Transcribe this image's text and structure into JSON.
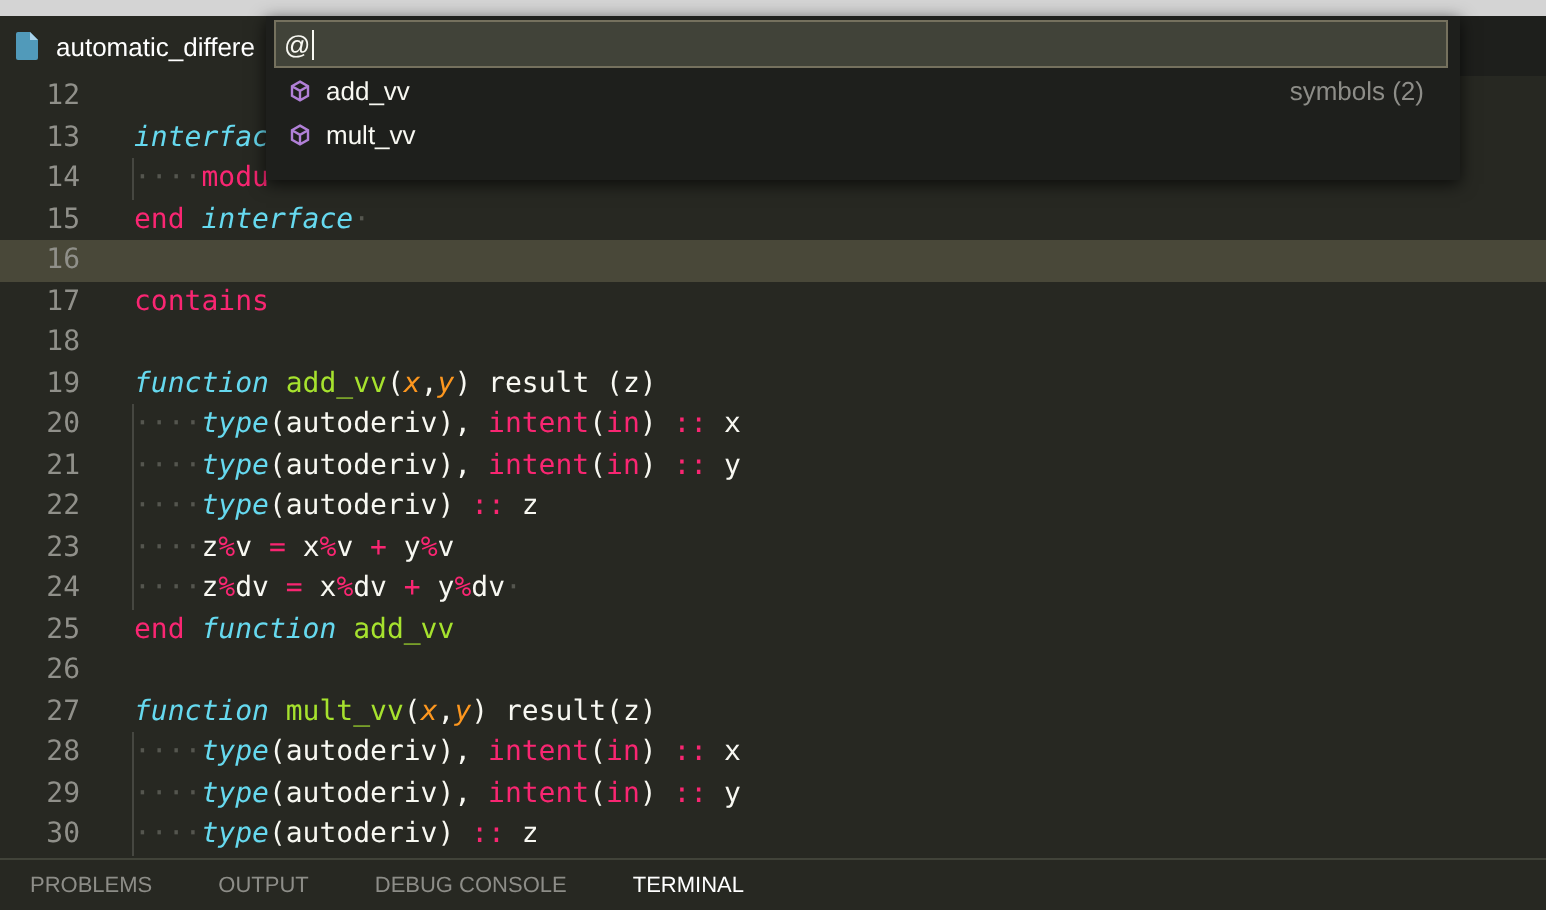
{
  "tab": {
    "title": "automatic_differe"
  },
  "command_palette": {
    "query": "@",
    "hint": "symbols (2)",
    "results": [
      {
        "label": "add_vv"
      },
      {
        "label": "mult_vv"
      }
    ]
  },
  "editor": {
    "lines": [
      {
        "number": "12",
        "current": false
      },
      {
        "number": "13",
        "current": false,
        "tokens": [
          {
            "kind": "storage",
            "text": "interfac"
          }
        ]
      },
      {
        "number": "14",
        "current": false,
        "tokens": [
          {
            "kind": "ws",
            "text": "····"
          },
          {
            "kind": "kw",
            "text": "modu"
          }
        ]
      },
      {
        "number": "15",
        "current": false,
        "tokens": [
          {
            "kind": "kw",
            "text": "end"
          },
          {
            "kind": "storage",
            "text": " interface"
          },
          {
            "kind": "ws",
            "text": "·"
          }
        ]
      },
      {
        "number": "16",
        "current": true
      },
      {
        "number": "17",
        "current": false,
        "tokens": [
          {
            "kind": "kw",
            "text": "contains"
          }
        ]
      },
      {
        "number": "18",
        "current": false
      },
      {
        "number": "19",
        "current": false,
        "tokens": [
          {
            "kind": "storage",
            "text": "function"
          },
          {
            "kind": "fn",
            "text": " add_vv"
          },
          {
            "kind": "plain",
            "text": "("
          },
          {
            "kind": "param",
            "text": "x"
          },
          {
            "kind": "plain",
            "text": ","
          },
          {
            "kind": "param",
            "text": "y"
          },
          {
            "kind": "plain",
            "text": ") result (z)"
          }
        ]
      },
      {
        "number": "20",
        "current": false,
        "tokens": [
          {
            "kind": "ws",
            "text": "····"
          },
          {
            "kind": "storage",
            "text": "type"
          },
          {
            "kind": "plain",
            "text": "(autoderiv), "
          },
          {
            "kind": "kw",
            "text": "intent"
          },
          {
            "kind": "plain",
            "text": "("
          },
          {
            "kind": "kw",
            "text": "in"
          },
          {
            "kind": "plain",
            "text": ") "
          },
          {
            "kind": "kw",
            "text": "::"
          },
          {
            "kind": "plain",
            "text": " x"
          }
        ]
      },
      {
        "number": "21",
        "current": false,
        "tokens": [
          {
            "kind": "ws",
            "text": "····"
          },
          {
            "kind": "storage",
            "text": "type"
          },
          {
            "kind": "plain",
            "text": "(autoderiv), "
          },
          {
            "kind": "kw",
            "text": "intent"
          },
          {
            "kind": "plain",
            "text": "("
          },
          {
            "kind": "kw",
            "text": "in"
          },
          {
            "kind": "plain",
            "text": ") "
          },
          {
            "kind": "kw",
            "text": "::"
          },
          {
            "kind": "plain",
            "text": " y"
          }
        ]
      },
      {
        "number": "22",
        "current": false,
        "tokens": [
          {
            "kind": "ws",
            "text": "····"
          },
          {
            "kind": "storage",
            "text": "type"
          },
          {
            "kind": "plain",
            "text": "(autoderiv) "
          },
          {
            "kind": "kw",
            "text": "::"
          },
          {
            "kind": "plain",
            "text": " z"
          }
        ]
      },
      {
        "number": "23",
        "current": false,
        "tokens": [
          {
            "kind": "ws",
            "text": "····"
          },
          {
            "kind": "plain",
            "text": "z"
          },
          {
            "kind": "kw",
            "text": "%"
          },
          {
            "kind": "plain",
            "text": "v "
          },
          {
            "kind": "kw",
            "text": "="
          },
          {
            "kind": "plain",
            "text": " x"
          },
          {
            "kind": "kw",
            "text": "%"
          },
          {
            "kind": "plain",
            "text": "v "
          },
          {
            "kind": "kw",
            "text": "+"
          },
          {
            "kind": "plain",
            "text": " y"
          },
          {
            "kind": "kw",
            "text": "%"
          },
          {
            "kind": "plain",
            "text": "v"
          }
        ]
      },
      {
        "number": "24",
        "current": false,
        "tokens": [
          {
            "kind": "ws",
            "text": "····"
          },
          {
            "kind": "plain",
            "text": "z"
          },
          {
            "kind": "kw",
            "text": "%"
          },
          {
            "kind": "plain",
            "text": "dv "
          },
          {
            "kind": "kw",
            "text": "="
          },
          {
            "kind": "plain",
            "text": " x"
          },
          {
            "kind": "kw",
            "text": "%"
          },
          {
            "kind": "plain",
            "text": "dv "
          },
          {
            "kind": "kw",
            "text": "+"
          },
          {
            "kind": "plain",
            "text": " y"
          },
          {
            "kind": "kw",
            "text": "%"
          },
          {
            "kind": "plain",
            "text": "dv"
          },
          {
            "kind": "ws",
            "text": "·"
          }
        ]
      },
      {
        "number": "25",
        "current": false,
        "tokens": [
          {
            "kind": "kw",
            "text": "end"
          },
          {
            "kind": "storage",
            "text": " function"
          },
          {
            "kind": "fn",
            "text": " add_vv"
          }
        ]
      },
      {
        "number": "26",
        "current": false
      },
      {
        "number": "27",
        "current": false,
        "tokens": [
          {
            "kind": "storage",
            "text": "function"
          },
          {
            "kind": "fn",
            "text": " mult_vv"
          },
          {
            "kind": "plain",
            "text": "("
          },
          {
            "kind": "param",
            "text": "x"
          },
          {
            "kind": "plain",
            "text": ","
          },
          {
            "kind": "param",
            "text": "y"
          },
          {
            "kind": "plain",
            "text": ") result(z)"
          }
        ]
      },
      {
        "number": "28",
        "current": false,
        "tokens": [
          {
            "kind": "ws",
            "text": "····"
          },
          {
            "kind": "storage",
            "text": "type"
          },
          {
            "kind": "plain",
            "text": "(autoderiv), "
          },
          {
            "kind": "kw",
            "text": "intent"
          },
          {
            "kind": "plain",
            "text": "("
          },
          {
            "kind": "kw",
            "text": "in"
          },
          {
            "kind": "plain",
            "text": ") "
          },
          {
            "kind": "kw",
            "text": "::"
          },
          {
            "kind": "plain",
            "text": " x"
          }
        ]
      },
      {
        "number": "29",
        "current": false,
        "tokens": [
          {
            "kind": "ws",
            "text": "····"
          },
          {
            "kind": "storage",
            "text": "type"
          },
          {
            "kind": "plain",
            "text": "(autoderiv), "
          },
          {
            "kind": "kw",
            "text": "intent"
          },
          {
            "kind": "plain",
            "text": "("
          },
          {
            "kind": "kw",
            "text": "in"
          },
          {
            "kind": "plain",
            "text": ") "
          },
          {
            "kind": "kw",
            "text": "::"
          },
          {
            "kind": "plain",
            "text": " y"
          }
        ]
      },
      {
        "number": "30",
        "current": false,
        "tokens": [
          {
            "kind": "ws",
            "text": "····"
          },
          {
            "kind": "storage",
            "text": "type"
          },
          {
            "kind": "plain",
            "text": "(autoderiv) "
          },
          {
            "kind": "kw",
            "text": "::"
          },
          {
            "kind": "plain",
            "text": " z"
          }
        ]
      }
    ]
  },
  "panel": {
    "tabs": [
      {
        "label": "PROBLEMS",
        "selected": false
      },
      {
        "label": "OUTPUT",
        "selected": false
      },
      {
        "label": "DEBUG CONSOLE",
        "selected": false
      },
      {
        "label": "TERMINAL",
        "selected": true
      }
    ]
  }
}
